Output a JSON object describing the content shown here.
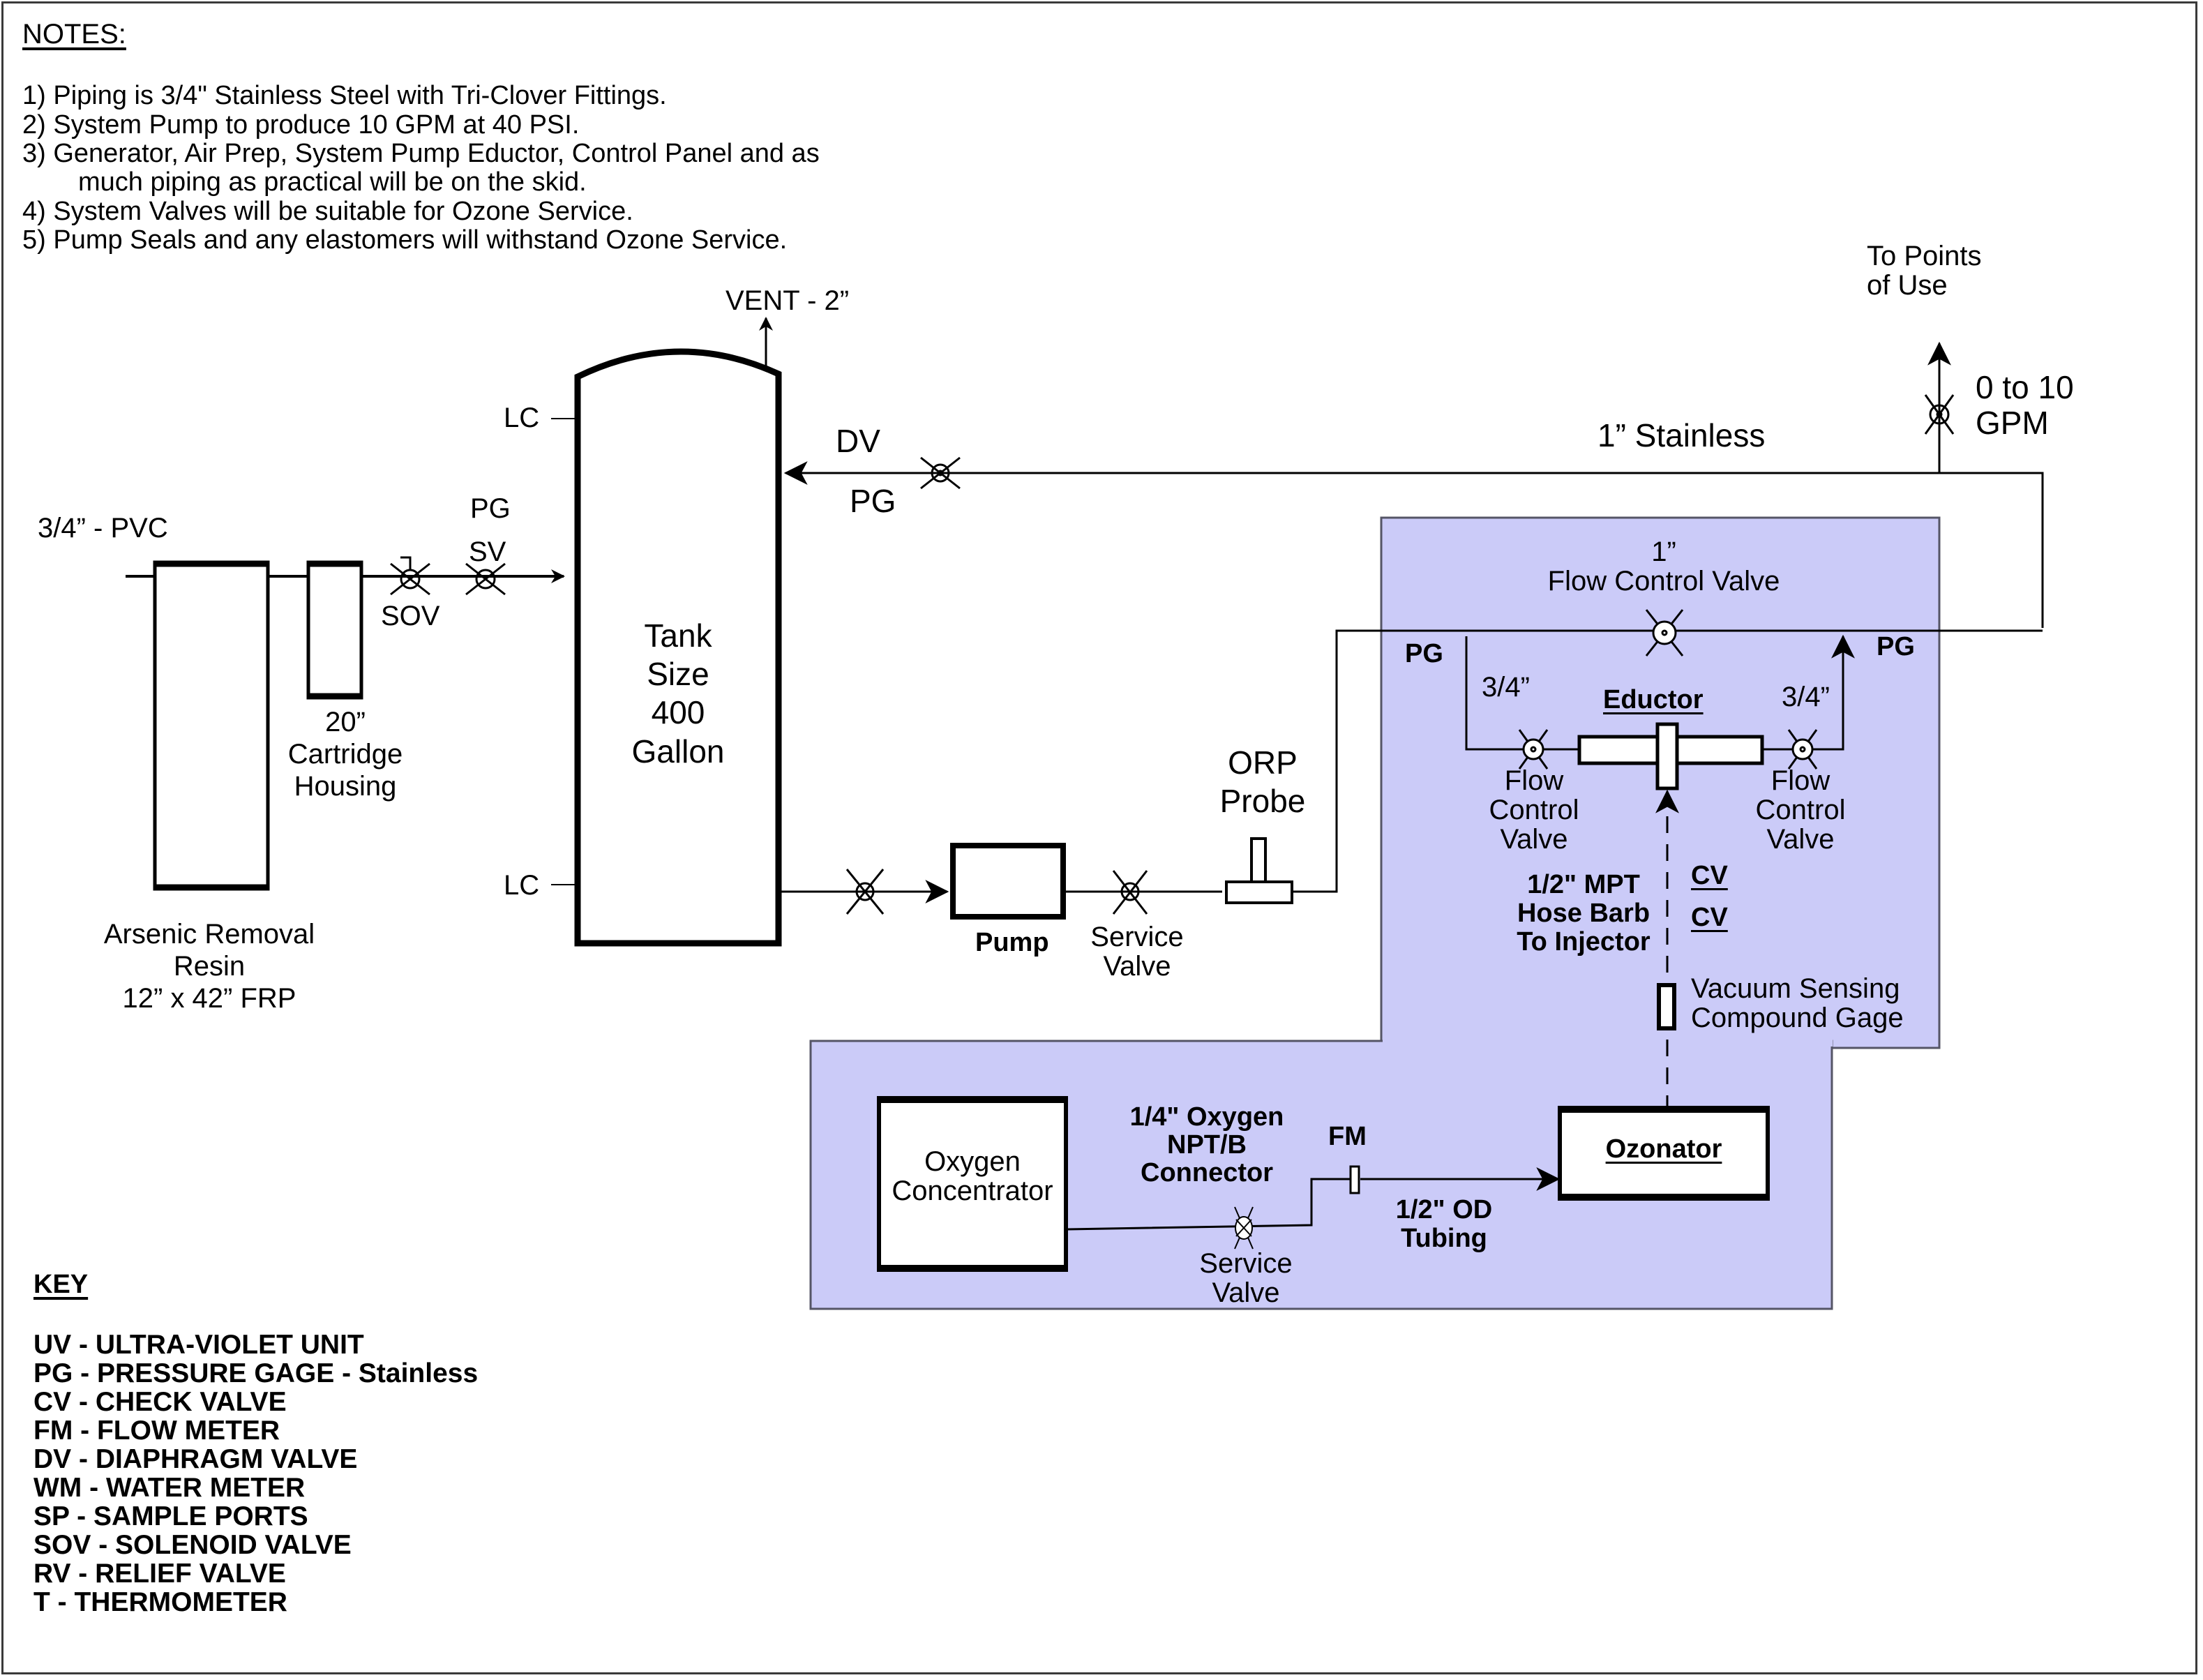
{
  "notes": {
    "title": "NOTES:",
    "items": [
      "1)  Piping is 3/4\" Stainless Steel with Tri-Clover Fittings.",
      "2)  System Pump to produce 10 GPM at 40 PSI.",
      "3)  Generator, Air Prep, System Pump Eductor, Control Panel and as",
      "much piping as practical will be on the skid.",
      "4)  System Valves will be suitable for Ozone Service.",
      "5)  Pump Seals and any elastomers will withstand Ozone Service."
    ]
  },
  "labels": {
    "pvc_inlet": "3/4” - PVC",
    "pg_inlet": "PG",
    "sv_inlet": "SV",
    "sov": "SOV",
    "cartridge": [
      "20”",
      "Cartridge",
      "Housing"
    ],
    "resin": [
      "Arsenic Removal",
      "Resin",
      "12” x 42” FRP"
    ],
    "vent": "VENT - 2”",
    "lc_top": "LC",
    "lc_bottom": "LC",
    "tank": [
      "Tank",
      "Size",
      "400",
      "Gallon"
    ],
    "dv": "DV",
    "pg_return": "PG",
    "stainless": "1” Stainless",
    "points_of_use": [
      "To Points",
      "of Use"
    ],
    "flow_range": [
      "0 to 10",
      "GPM"
    ],
    "pump": "Pump",
    "service_valve_pump": [
      "Service",
      "Valve"
    ],
    "orp_probe": [
      "ORP",
      "Probe"
    ]
  },
  "eductor_panel": {
    "fcv_1in": [
      "1”",
      "Flow Control Valve"
    ],
    "pg_left": "PG",
    "pg_right": "PG",
    "size_left": "3/4”",
    "size_right": "3/4”",
    "eductor": "Eductor",
    "fcv_left": [
      "Flow",
      "Control",
      "Valve"
    ],
    "fcv_right": [
      "Flow",
      "Control",
      "Valve"
    ],
    "hose_barb": [
      "1/2\" MPT",
      "Hose Barb",
      "To Injector"
    ],
    "cv_1": "CV",
    "cv_2": "CV",
    "vacuum_gage": [
      "Vacuum Sensing",
      "Compound Gage"
    ]
  },
  "ozone_panel": {
    "oxygen_concentrator": [
      "Oxygen",
      "Concentrator"
    ],
    "oxygen_connector": [
      "1/4\" Oxygen",
      "NPT/B",
      "Connector"
    ],
    "fm": "FM",
    "service_valve": [
      "Service",
      "Valve"
    ],
    "tubing": [
      "1/2\" OD",
      "Tubing"
    ],
    "ozonator": "Ozonator"
  },
  "key": {
    "title": "KEY",
    "items": [
      "UV - ULTRA-VIOLET UNIT",
      "PG - PRESSURE GAGE  -  Stainless",
      "CV  -  CHECK VALVE",
      "FM - FLOW METER",
      "DV  - DIAPHRAGM VALVE",
      "WM  -  WATER METER",
      "SP  -  SAMPLE PORTS",
      "SOV  -  SOLENOID VALVE",
      "RV  -  RELIEF VALVE",
      "T  -  THERMOMETER"
    ]
  },
  "colors": {
    "panel_fill": "#cbcbf8",
    "panel_border": "#555566",
    "line": "#000000"
  }
}
